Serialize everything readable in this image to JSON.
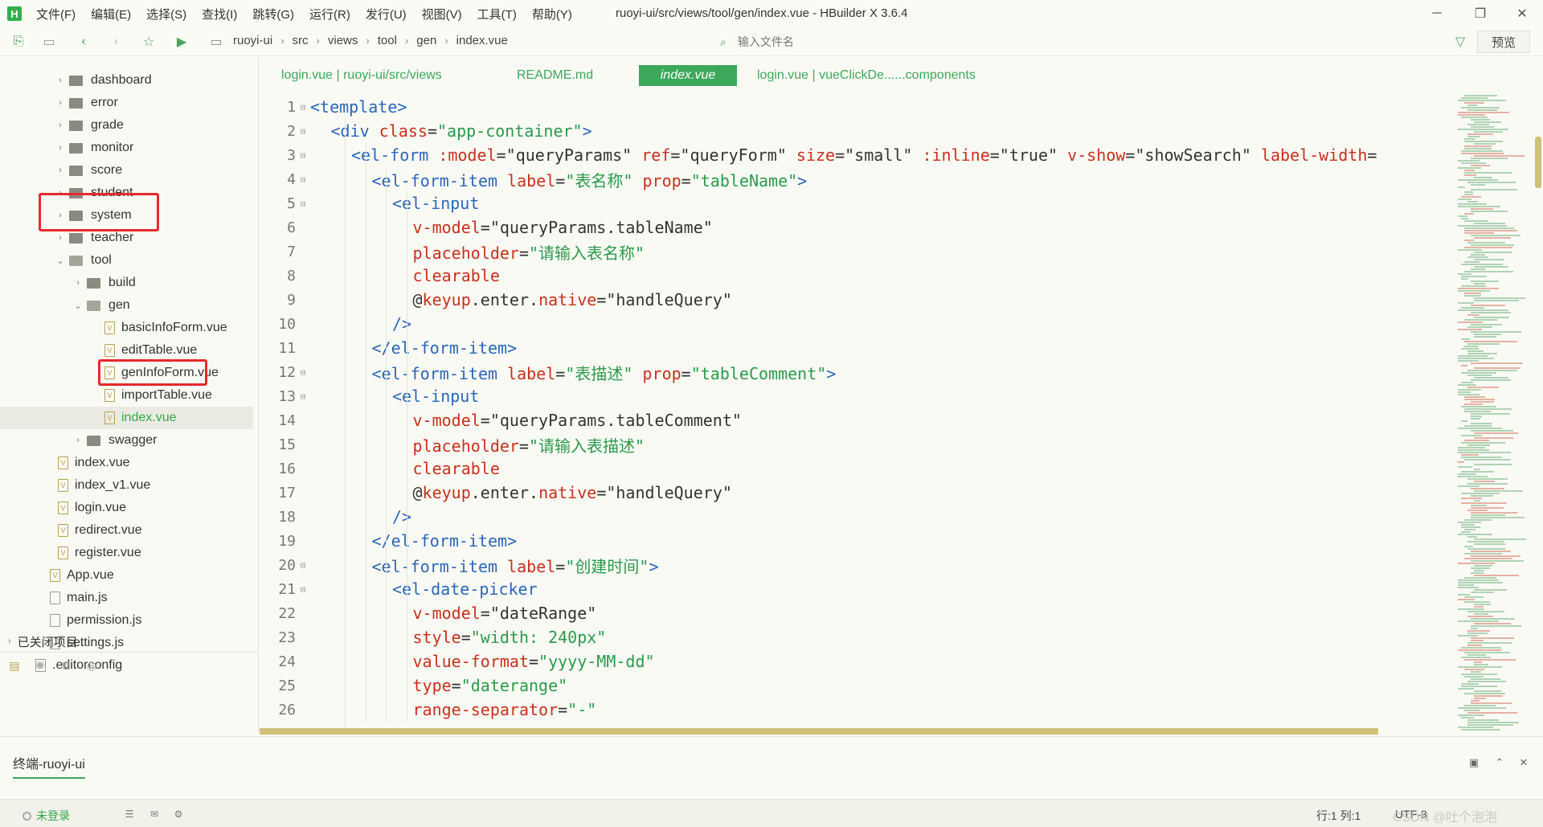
{
  "app": {
    "logo": "H",
    "window_title": "ruoyi-ui/src/views/tool/gen/index.vue - HBuilder X 3.6.4"
  },
  "menu": [
    "文件(F)",
    "编辑(E)",
    "选择(S)",
    "查找(I)",
    "跳转(G)",
    "运行(R)",
    "发行(U)",
    "视图(V)",
    "工具(T)",
    "帮助(Y)"
  ],
  "window_controls": {
    "minimize": "─",
    "maximize": "❐",
    "close": "✕"
  },
  "toolbar": {
    "breadcrumb": [
      "ruoyi-ui",
      "src",
      "views",
      "tool",
      "gen",
      "index.vue"
    ],
    "file_search_placeholder": "输入文件名",
    "preview_label": "预览"
  },
  "sidebar": {
    "tree": [
      {
        "label": "dashboard",
        "type": "folder",
        "depth": 0,
        "expanded": false
      },
      {
        "label": "error",
        "type": "folder",
        "depth": 0,
        "expanded": false
      },
      {
        "label": "grade",
        "type": "folder",
        "depth": 0,
        "expanded": false
      },
      {
        "label": "monitor",
        "type": "folder",
        "depth": 0,
        "expanded": false
      },
      {
        "label": "score",
        "type": "folder",
        "depth": 0,
        "expanded": false
      },
      {
        "label": "student",
        "type": "folder",
        "depth": 0,
        "expanded": false
      },
      {
        "label": "system",
        "type": "folder",
        "depth": 0,
        "expanded": false
      },
      {
        "label": "teacher",
        "type": "folder",
        "depth": 0,
        "expanded": false
      },
      {
        "label": "tool",
        "type": "folder",
        "depth": 0,
        "expanded": true
      },
      {
        "label": "build",
        "type": "folder",
        "depth": 1,
        "expanded": false
      },
      {
        "label": "gen",
        "type": "folder",
        "depth": 1,
        "expanded": true
      },
      {
        "label": "basicInfoForm.vue",
        "type": "vue",
        "depth": 2
      },
      {
        "label": "editTable.vue",
        "type": "vue",
        "depth": 2
      },
      {
        "label": "genInfoForm.vue",
        "type": "vue",
        "depth": 2
      },
      {
        "label": "importTable.vue",
        "type": "vue",
        "depth": 2
      },
      {
        "label": "index.vue",
        "type": "vue",
        "depth": 2,
        "active": true
      },
      {
        "label": "swagger",
        "type": "folder",
        "depth": 1,
        "expanded": false
      },
      {
        "label": "index.vue",
        "type": "vue",
        "depth": 0,
        "file": true
      },
      {
        "label": "index_v1.vue",
        "type": "vue",
        "depth": 0,
        "file": true
      },
      {
        "label": "login.vue",
        "type": "vue",
        "depth": 0,
        "file": true
      },
      {
        "label": "redirect.vue",
        "type": "vue",
        "depth": 0,
        "file": true
      },
      {
        "label": "register.vue",
        "type": "vue",
        "depth": 0,
        "file": true
      },
      {
        "label": "App.vue",
        "type": "vue",
        "depth": -1,
        "file": true
      },
      {
        "label": "main.js",
        "type": "js",
        "depth": -1,
        "file": true
      },
      {
        "label": "permission.js",
        "type": "js",
        "depth": -1,
        "file": true
      },
      {
        "label": "settings.js",
        "type": "js",
        "depth": -1,
        "file": true
      },
      {
        "label": ".editorconfig",
        "type": "plain",
        "depth": -2,
        "file": true
      }
    ],
    "closed_projects": "已关闭项目"
  },
  "tabs": [
    {
      "label": "login.vue | ruoyi-ui/src/views",
      "active": false
    },
    {
      "label": "README.md",
      "active": false
    },
    {
      "label": "index.vue",
      "active": true
    },
    {
      "label": "login.vue | vueClickDe......components",
      "active": false
    }
  ],
  "code": [
    {
      "n": "1",
      "fold": true,
      "indent": 0,
      "tokens": [
        [
          "t",
          "<template>"
        ]
      ]
    },
    {
      "n": "2",
      "fold": true,
      "indent": 1,
      "tokens": [
        [
          "t",
          "<div "
        ],
        [
          "a",
          "class"
        ],
        [
          "p",
          "="
        ],
        [
          "s",
          "\"app-container\""
        ],
        [
          "t",
          ">"
        ]
      ]
    },
    {
      "n": "3",
      "fold": true,
      "indent": 2,
      "tokens": [
        [
          "t",
          "<el-form "
        ],
        [
          "a",
          ":model"
        ],
        [
          "p",
          "=\"queryParams\" "
        ],
        [
          "a",
          "ref"
        ],
        [
          "p",
          "=\"queryForm\" "
        ],
        [
          "a",
          "size"
        ],
        [
          "p",
          "=\"small\" "
        ],
        [
          "a",
          ":inline"
        ],
        [
          "p",
          "=\"true\" "
        ],
        [
          "a",
          "v-show"
        ],
        [
          "p",
          "=\"showSearch\" "
        ],
        [
          "a",
          "label-width"
        ],
        [
          "p",
          "="
        ]
      ]
    },
    {
      "n": "4",
      "fold": true,
      "indent": 3,
      "tokens": [
        [
          "t",
          "<el-form-item "
        ],
        [
          "a",
          "label"
        ],
        [
          "p",
          "="
        ],
        [
          "s",
          "\"表名称\""
        ],
        [
          "p",
          " "
        ],
        [
          "a",
          "prop"
        ],
        [
          "p",
          "="
        ],
        [
          "s",
          "\"tableName\""
        ],
        [
          "t",
          ">"
        ]
      ]
    },
    {
      "n": "5",
      "fold": true,
      "indent": 4,
      "tokens": [
        [
          "t",
          "<el-input"
        ]
      ]
    },
    {
      "n": "6",
      "fold": false,
      "indent": 5,
      "tokens": [
        [
          "a",
          "v-model"
        ],
        [
          "p",
          "=\"queryParams.tableName\""
        ]
      ]
    },
    {
      "n": "7",
      "fold": false,
      "indent": 5,
      "tokens": [
        [
          "a",
          "placeholder"
        ],
        [
          "p",
          "="
        ],
        [
          "s",
          "\"请输入表名称\""
        ]
      ]
    },
    {
      "n": "8",
      "fold": false,
      "indent": 5,
      "tokens": [
        [
          "a",
          "clearable"
        ]
      ]
    },
    {
      "n": "9",
      "fold": false,
      "indent": 5,
      "tokens": [
        [
          "p",
          "@"
        ],
        [
          "a",
          "keyup"
        ],
        [
          "p",
          ".enter."
        ],
        [
          "a",
          "native"
        ],
        [
          "p",
          "=\"handleQuery\""
        ]
      ]
    },
    {
      "n": "10",
      "fold": false,
      "indent": 4,
      "tokens": [
        [
          "t",
          "/>"
        ]
      ]
    },
    {
      "n": "11",
      "fold": false,
      "indent": 3,
      "tokens": [
        [
          "t",
          "</el-form-item>"
        ]
      ]
    },
    {
      "n": "12",
      "fold": true,
      "indent": 3,
      "tokens": [
        [
          "t",
          "<el-form-item "
        ],
        [
          "a",
          "label"
        ],
        [
          "p",
          "="
        ],
        [
          "s",
          "\"表描述\""
        ],
        [
          "p",
          " "
        ],
        [
          "a",
          "prop"
        ],
        [
          "p",
          "="
        ],
        [
          "s",
          "\"tableComment\""
        ],
        [
          "t",
          ">"
        ]
      ]
    },
    {
      "n": "13",
      "fold": true,
      "indent": 4,
      "tokens": [
        [
          "t",
          "<el-input"
        ]
      ]
    },
    {
      "n": "14",
      "fold": false,
      "indent": 5,
      "tokens": [
        [
          "a",
          "v-model"
        ],
        [
          "p",
          "=\"queryParams.tableComment\""
        ]
      ]
    },
    {
      "n": "15",
      "fold": false,
      "indent": 5,
      "tokens": [
        [
          "a",
          "placeholder"
        ],
        [
          "p",
          "="
        ],
        [
          "s",
          "\"请输入表描述\""
        ]
      ]
    },
    {
      "n": "16",
      "fold": false,
      "indent": 5,
      "tokens": [
        [
          "a",
          "clearable"
        ]
      ]
    },
    {
      "n": "17",
      "fold": false,
      "indent": 5,
      "tokens": [
        [
          "p",
          "@"
        ],
        [
          "a",
          "keyup"
        ],
        [
          "p",
          ".enter."
        ],
        [
          "a",
          "native"
        ],
        [
          "p",
          "=\"handleQuery\""
        ]
      ]
    },
    {
      "n": "18",
      "fold": false,
      "indent": 4,
      "tokens": [
        [
          "t",
          "/>"
        ]
      ]
    },
    {
      "n": "19",
      "fold": false,
      "indent": 3,
      "tokens": [
        [
          "t",
          "</el-form-item>"
        ]
      ]
    },
    {
      "n": "20",
      "fold": true,
      "indent": 3,
      "tokens": [
        [
          "t",
          "<el-form-item "
        ],
        [
          "a",
          "label"
        ],
        [
          "p",
          "="
        ],
        [
          "s",
          "\"创建时间\""
        ],
        [
          "t",
          ">"
        ]
      ]
    },
    {
      "n": "21",
      "fold": true,
      "indent": 4,
      "tokens": [
        [
          "t",
          "<el-date-picker"
        ]
      ]
    },
    {
      "n": "22",
      "fold": false,
      "indent": 5,
      "tokens": [
        [
          "a",
          "v-model"
        ],
        [
          "p",
          "=\"dateRange\""
        ]
      ]
    },
    {
      "n": "23",
      "fold": false,
      "indent": 5,
      "tokens": [
        [
          "a",
          "style"
        ],
        [
          "p",
          "="
        ],
        [
          "s",
          "\"width: 240px\""
        ]
      ]
    },
    {
      "n": "24",
      "fold": false,
      "indent": 5,
      "tokens": [
        [
          "a",
          "value-format"
        ],
        [
          "p",
          "="
        ],
        [
          "s",
          "\"yyyy-MM-dd\""
        ]
      ]
    },
    {
      "n": "25",
      "fold": false,
      "indent": 5,
      "tokens": [
        [
          "a",
          "type"
        ],
        [
          "p",
          "="
        ],
        [
          "s",
          "\"daterange\""
        ]
      ]
    },
    {
      "n": "26",
      "fold": false,
      "indent": 5,
      "tokens": [
        [
          "a",
          "range-separator"
        ],
        [
          "p",
          "="
        ],
        [
          "s",
          "\"-\""
        ]
      ]
    }
  ],
  "terminal": {
    "tab_label": "终端-ruoyi-ui"
  },
  "status": {
    "login": "未登录",
    "position": "行:1  列:1",
    "encoding": "UTF-8"
  },
  "watermark": "CSDN @吐个泡泡",
  "colors": {
    "accent": "#3ca85a",
    "highlight_box": "#e52a2a",
    "tag": "#2a66b8",
    "attr": "#c8301a",
    "string": "#2a9a4a"
  }
}
